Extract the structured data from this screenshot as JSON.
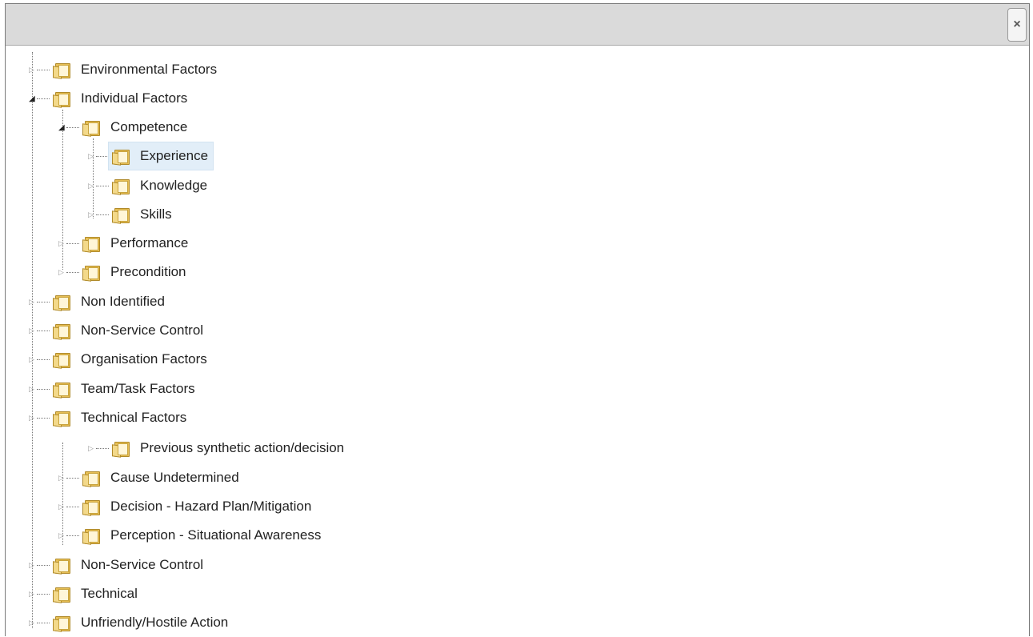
{
  "dialog": {
    "close_glyph": "×",
    "close_icon": "close-icon"
  },
  "tree": {
    "toggle_closed_glyph": "▷",
    "toggle_open_glyph": "◢",
    "folder_icon": "folder-icon",
    "nodes": [
      {
        "label": "Environmental Factors",
        "expanded": false
      },
      {
        "label": "Individual Factors",
        "expanded": true
      },
      {
        "label": "Competence",
        "expanded": true
      },
      {
        "label": "Experience",
        "expanded": false,
        "selected": true
      },
      {
        "label": "Knowledge",
        "expanded": false
      },
      {
        "label": "Skills",
        "expanded": false
      },
      {
        "label": "Performance",
        "expanded": false
      },
      {
        "label": "Precondition",
        "expanded": false
      },
      {
        "label": "Non Identified",
        "expanded": false
      },
      {
        "label": "Non-Service Control",
        "expanded": false
      },
      {
        "label": "Organisation Factors",
        "expanded": false
      },
      {
        "label": "Team/Task Factors",
        "expanded": false
      },
      {
        "label": "Technical Factors",
        "expanded": false
      },
      {
        "label": "Previous synthetic action/decision",
        "expanded": false
      },
      {
        "label": "Cause Undetermined",
        "expanded": false
      },
      {
        "label": "Decision - Hazard Plan/Mitigation",
        "expanded": false
      },
      {
        "label": "Perception - Situational Awareness",
        "expanded": false
      },
      {
        "label": "Non-Service Control",
        "expanded": false
      },
      {
        "label": "Technical",
        "expanded": false
      },
      {
        "label": "Unfriendly/Hostile Action",
        "expanded": false
      }
    ]
  },
  "colors": {
    "selection_bg": "#e2eef8",
    "titlebar_bg": "#dadada",
    "folder": "#e7bf55"
  }
}
